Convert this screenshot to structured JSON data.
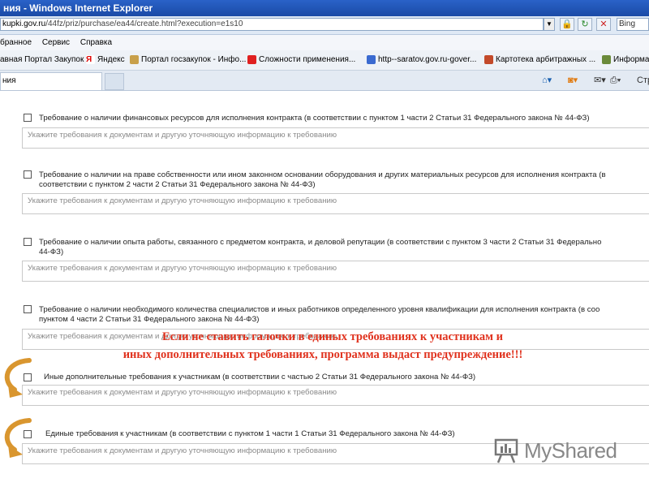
{
  "window": {
    "title": "ния - Windows Internet Explorer"
  },
  "address": {
    "host": "kupki.gov.ru",
    "path": "/44fz/priz/purchase/ea44/create.html?execution=e1s10"
  },
  "search": {
    "placeholder": "Bing"
  },
  "menu": {
    "items": [
      "бранное",
      "Сервис",
      "Справка"
    ]
  },
  "favorites": [
    "авная Портал Закупок",
    "Яндекс",
    "Портал госзакупок - Инфо...",
    "Сложности применения...",
    "http--saratov.gov.ru-gover...",
    "Картотека арбитражных ...",
    "Информа"
  ],
  "tabs": {
    "active": "ния"
  },
  "commandbar": {
    "page_label": "Стр"
  },
  "requirements": [
    {
      "label_lines": [
        "Требование о наличии финансовых ресурсов для исполнения контракта (в соответствии с пунктом 1 части 2 Статьи 31 Федерального закона № 44-ФЗ)"
      ],
      "placeholder": "Укажите требования к документам и другую уточняющую информацию к требованию"
    },
    {
      "label_lines": [
        "Требование о наличии на праве собственности или ином законном основании оборудования и других материальных ресурсов для исполнения контракта (в",
        "соответствии с пунктом 2 части 2 Статьи 31 Федерального закона № 44-ФЗ)"
      ],
      "placeholder": "Укажите требования к документам и другую уточняющую информацию к требованию"
    },
    {
      "label_lines": [
        "Требование о наличии опыта работы, связанного с предметом контракта, и деловой репутации (в соответствии с пунктом 3 части 2 Статьи 31 Федерально",
        "44-ФЗ)"
      ],
      "placeholder": "Укажите требования к документам и другую уточняющую информацию к требованию"
    },
    {
      "label_lines": [
        "Требование о наличии необходимого количества специалистов и иных работников определенного уровня квалификации для исполнения контракта (в соо",
        "пунктом 4 части 2 Статьи 31 Федерального закона № 44-ФЗ)"
      ],
      "placeholder": "Укажите требования к документам и другую уточняющую информацию к требованию"
    },
    {
      "label_lines": [
        "Иные дополнительные требования к участникам (в соответствии с частью 2 Статьи 31 Федерального закона № 44-ФЗ)"
      ],
      "placeholder": "Укажите требования к документам и другую уточняющую информацию к требованию"
    },
    {
      "label_lines": [
        "Единые требования к участникам (в соответствии с пунктом 1 части 1 Статьи 31 Федерального закона № 44-ФЗ)"
      ],
      "placeholder": "Укажите требования к документам и другую уточняющую информацию к требованию"
    }
  ],
  "annotation": {
    "line1": "Если не ставить галочки в единых требованиях к участникам и",
    "line2": "иных дополнительных требованиях, программа выдаст предупреждение!!!"
  },
  "logo": {
    "text": "MyShared"
  },
  "colors": {
    "annotation": "#e0321e",
    "arrow": "#d9962f",
    "titlebar": "#2a62c8"
  }
}
